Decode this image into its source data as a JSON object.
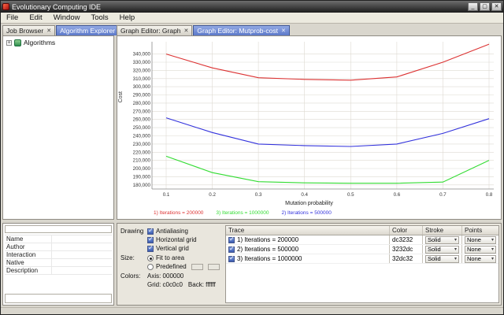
{
  "window": {
    "title": "Evolutionary Computing IDE",
    "controls": {
      "minimize": "_",
      "maximize": "▢",
      "close": "✕"
    }
  },
  "icons": {
    "close": "✕",
    "dropdown": "▾",
    "check": "✓",
    "expand": "+"
  },
  "menu": {
    "items": [
      "File",
      "Edit",
      "Window",
      "Tools",
      "Help"
    ]
  },
  "left_panel": {
    "tabs": [
      {
        "label": "Job Browser",
        "active": false
      },
      {
        "label": "Algorithm Explorer",
        "active": true
      }
    ],
    "tree": {
      "root_label": "Algorithms"
    },
    "properties": {
      "rows": [
        "Name",
        "Author",
        "Interaction",
        "Native",
        "Description"
      ]
    }
  },
  "right_panel": {
    "tabs": [
      {
        "label": "Graph Editor: Graph",
        "active": false
      },
      {
        "label": "Graph Editor: Mutprob-cost",
        "active": true
      }
    ]
  },
  "chart_data": {
    "type": "line",
    "title": "",
    "xlabel": "Mutation probability",
    "ylabel": "Cost",
    "x": [
      0.1,
      0.2,
      0.3,
      0.4,
      0.5,
      0.6,
      0.7,
      0.8
    ],
    "series": [
      {
        "name": "1) Iterations = 200000",
        "color": "#dc3232",
        "values": [
          340000,
          323000,
          311000,
          309000,
          308000,
          312000,
          330000,
          352000
        ]
      },
      {
        "name": "2) Iterations = 500000",
        "color": "#3232dc",
        "values": [
          262000,
          244000,
          230000,
          228000,
          227000,
          230000,
          243000,
          261000
        ]
      },
      {
        "name": "3) Iterations = 1000000",
        "color": "#32dc32",
        "values": [
          215000,
          195000,
          184000,
          182500,
          182000,
          182000,
          183500,
          210000
        ]
      }
    ],
    "ylim": [
      175000,
      355000
    ],
    "yticks": [
      180000,
      190000,
      200000,
      210000,
      220000,
      230000,
      240000,
      250000,
      260000,
      270000,
      280000,
      290000,
      300000,
      310000,
      320000,
      330000,
      340000
    ],
    "grid": true,
    "legend_position": "bottom",
    "legend": [
      {
        "text": "1) Iterations = 200000",
        "color": "#dc3232"
      },
      {
        "text": "3) Iterations = 1000000",
        "color": "#32dc32"
      },
      {
        "text": "2) Iterations = 500000",
        "color": "#3232dc"
      }
    ],
    "grid_color": "c0c0c0",
    "axis_color": "000000",
    "background_color": "ffffff"
  },
  "drawing": {
    "title": "Drawing",
    "checkboxes": [
      {
        "label": "Antialiasing",
        "checked": true
      },
      {
        "label": "Horizontal grid",
        "checked": true
      },
      {
        "label": "Vertical grid",
        "checked": true
      }
    ],
    "size_label": "Size:",
    "size_options": [
      {
        "label": "Fit to area",
        "selected": true
      },
      {
        "label": "Predefined",
        "selected": false
      }
    ],
    "colors_label": "Colors:",
    "color_items": [
      {
        "label": "Axis:",
        "value": "000000"
      },
      {
        "label": "Grid:",
        "value": "c0c0c0"
      },
      {
        "label": "Back:",
        "value": "ffffff"
      }
    ]
  },
  "trace": {
    "columns": [
      "Trace",
      "Color",
      "Stroke",
      "Points"
    ],
    "rows": [
      {
        "checked": true,
        "label": "1) Iterations = 200000",
        "color": "dc3232",
        "stroke": "Solid",
        "points": "None"
      },
      {
        "checked": true,
        "label": "2) Iterations = 500000",
        "color": "3232dc",
        "stroke": "Solid",
        "points": "None"
      },
      {
        "checked": true,
        "label": "3) Iterations = 1000000",
        "color": "32dc32",
        "stroke": "Solid",
        "points": "None"
      }
    ]
  }
}
